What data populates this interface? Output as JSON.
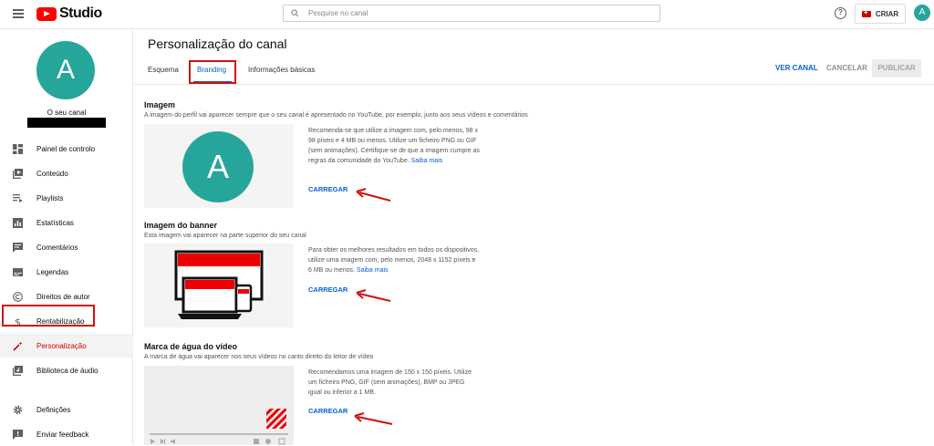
{
  "header": {
    "brand": "Studio",
    "search_placeholder": "Pesquise no canal",
    "help_glyph": "?",
    "create_label": "CRIAR",
    "avatar_letter": "A"
  },
  "sidebar": {
    "avatar_letter": "A",
    "channel_label": "O seu canal",
    "items": [
      {
        "label": "Painel de controlo",
        "icon": "dashboard-icon"
      },
      {
        "label": "Conteúdo",
        "icon": "content-icon"
      },
      {
        "label": "Playlists",
        "icon": "playlists-icon"
      },
      {
        "label": "Estatísticas",
        "icon": "analytics-icon"
      },
      {
        "label": "Comentários",
        "icon": "comments-icon"
      },
      {
        "label": "Legendas",
        "icon": "subtitles-icon"
      },
      {
        "label": "Direitos de autor",
        "icon": "copyright-icon"
      },
      {
        "label": "Rentabilização",
        "icon": "dollar-icon"
      },
      {
        "label": "Personalização",
        "icon": "magic-wand-icon"
      },
      {
        "label": "Biblioteca de áudio",
        "icon": "audio-library-icon"
      },
      {
        "label": "Definições",
        "icon": "gear-icon"
      },
      {
        "label": "Enviar feedback",
        "icon": "feedback-icon"
      }
    ],
    "active_item": "Personalização"
  },
  "main": {
    "title": "Personalização do canal",
    "tabs": [
      {
        "label": "Esquema"
      },
      {
        "label": "Branding"
      },
      {
        "label": "Informações básicas"
      }
    ],
    "active_tab": "Branding",
    "actions": {
      "view_channel": "VER CANAL",
      "cancel": "CANCELAR",
      "publish": "PUBLICAR"
    },
    "sections": {
      "image": {
        "title": "Imagem",
        "description": "A imagem do perfil vai aparecer sempre que o seu canal é apresentado no YouTube, por exemplo, junto aos seus vídeos e comentários",
        "preview_letter": "A",
        "help": "Recomenda-se que utilize a imagem com, pelo menos, 98 x 98 píxeis e 4 MB ou menos. Utilize um ficheiro PNG ou GIF (sem animações). Certifique-se de que a imagem cumpre as regras da comunidade do YouTube.",
        "link": "Saiba mais",
        "upload": "CARREGAR"
      },
      "banner": {
        "title": "Imagem do banner",
        "description": "Esta imagem vai aparecer na parte superior do seu canal",
        "help": "Para obter os melhores resultados em todos os dispositivos, utilize uma imagem com, pelo menos, 2048 x 1152 píxeis e 6 MB ou menos.",
        "link": "Saiba mais",
        "upload": "CARREGAR"
      },
      "watermark": {
        "title": "Marca de água do vídeo",
        "description": "A marca de água vai aparecer nos seus vídeos no canto direito do leitor de vídeo",
        "help": "Recomendamos uma imagem de 150 x 150 píxeis. Utilize um ficheiro PNG, GIF (sem animações), BMP ou JPEG igual ou inferior a 1 MB.",
        "upload": "CARREGAR"
      }
    }
  },
  "colors": {
    "accent_blue": "#065fd4",
    "brand_red": "#ff0000",
    "avatar_teal": "#26a69a",
    "annotation_red": "#d21010"
  }
}
